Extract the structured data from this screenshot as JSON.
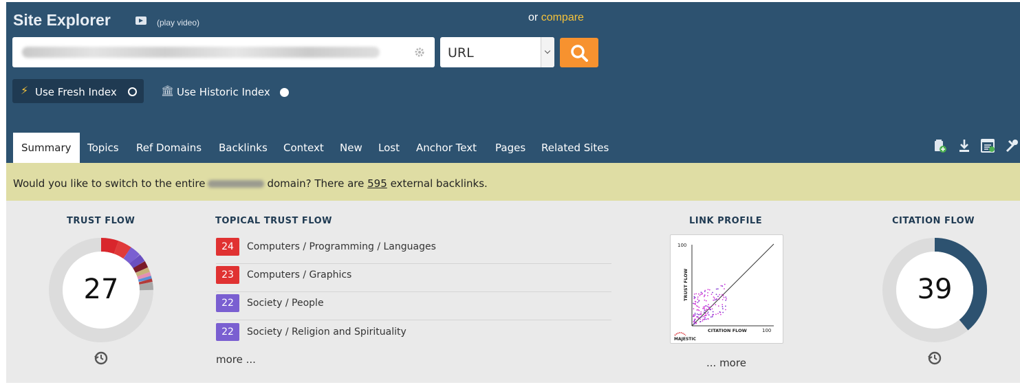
{
  "header": {
    "title": "Site Explorer",
    "play_video": "(play video)",
    "or_text": "or",
    "compare_link": "compare"
  },
  "search": {
    "select_value": "URL"
  },
  "index": {
    "fresh_label": "Use Fresh Index",
    "historic_label": "Use Historic Index",
    "fresh_selected": true
  },
  "tabs": [
    {
      "label": "Summary",
      "active": true
    },
    {
      "label": "Topics"
    },
    {
      "label": "Ref Domains"
    },
    {
      "label": "Backlinks"
    },
    {
      "label": "Context"
    },
    {
      "label": "New"
    },
    {
      "label": "Lost"
    },
    {
      "label": "Anchor Text"
    },
    {
      "label": "Pages"
    },
    {
      "label": "Related Sites"
    }
  ],
  "banner": {
    "prefix": "Would you like to switch to the entire",
    "middle": "domain? There are",
    "count": "595",
    "suffix": "external backlinks."
  },
  "trust_flow": {
    "title": "TRUST FLOW",
    "value": "27"
  },
  "topical": {
    "title": "TOPICAL TRUST FLOW",
    "items": [
      {
        "score": "24",
        "label": "Computers / Programming / Languages",
        "color": "#e03232"
      },
      {
        "score": "23",
        "label": "Computers / Graphics",
        "color": "#e03232"
      },
      {
        "score": "22",
        "label": "Society / People",
        "color": "#7a5fd1"
      },
      {
        "score": "22",
        "label": "Society / Religion and Spirituality",
        "color": "#7a5fd1"
      }
    ],
    "more": "more ..."
  },
  "link_profile": {
    "title": "LINK PROFILE",
    "axis_y": "TRUST FLOW",
    "axis_x": "CITATION FLOW",
    "tick_100_y": "100",
    "tick_100_x": "100",
    "brand": "MAJESTIC",
    "more": "... more"
  },
  "citation_flow": {
    "title": "CITATION FLOW",
    "value": "39"
  },
  "colors": {
    "header_bg": "#2d5270",
    "accent_orange": "#f7922f",
    "banner_bg": "#dfdda4",
    "gauge_fill": "#2d5270"
  }
}
